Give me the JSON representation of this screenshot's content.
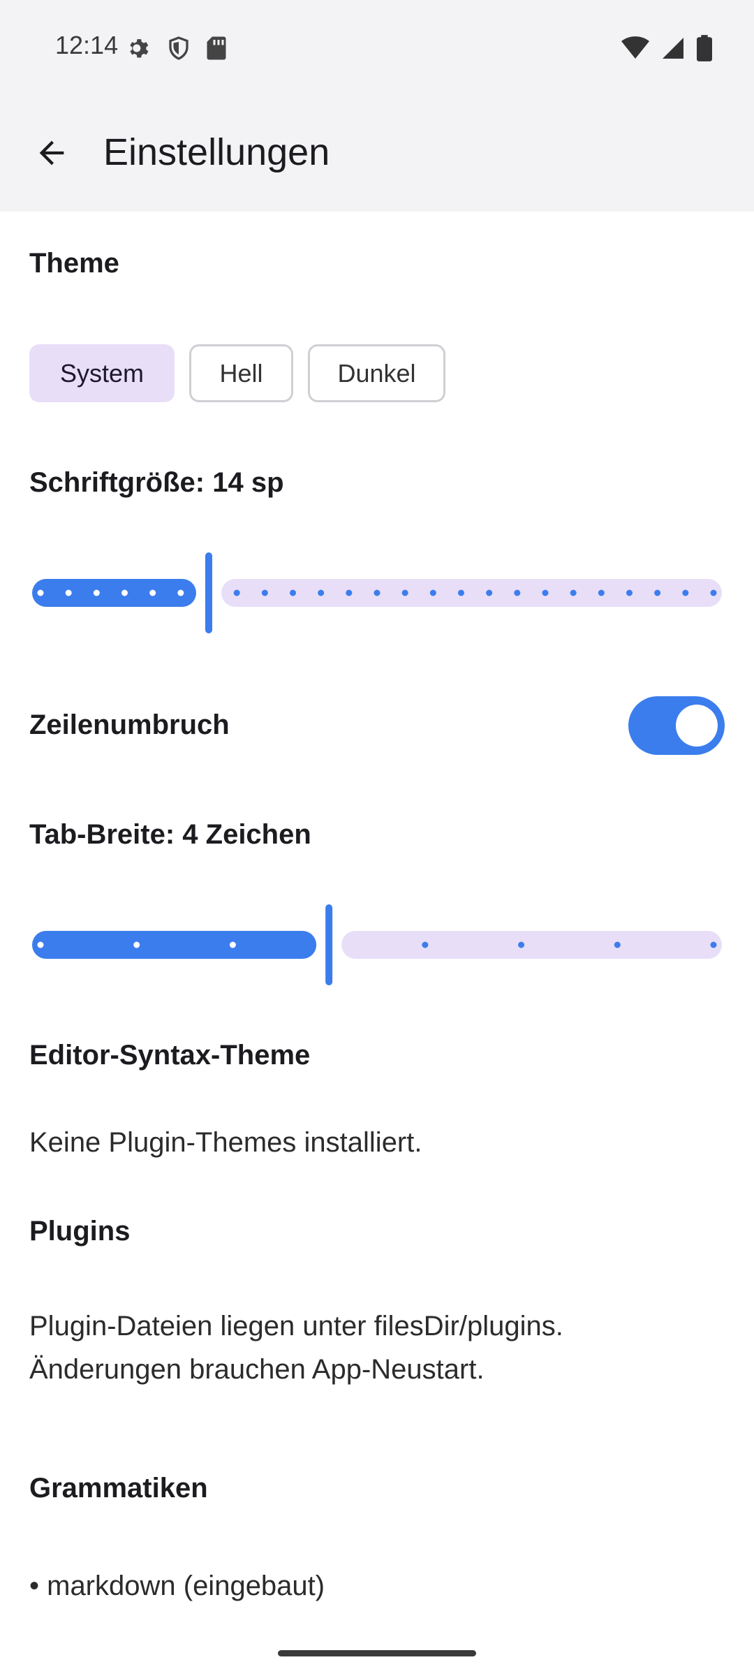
{
  "status": {
    "time": "12:14",
    "left_icons": [
      "gear-icon",
      "shield-icon",
      "sd-card-icon"
    ],
    "right_icons": [
      "wifi-icon",
      "signal-icon",
      "battery-icon"
    ]
  },
  "appbar": {
    "title": "Einstellungen",
    "back_icon": "arrow-back-icon"
  },
  "theme": {
    "title": "Theme",
    "options": [
      {
        "label": "System",
        "selected": true
      },
      {
        "label": "Hell",
        "selected": false
      },
      {
        "label": "Dunkel",
        "selected": false
      }
    ]
  },
  "font_size": {
    "title": "Schriftgröße: 14 sp",
    "value": 14,
    "min": 8,
    "max": 32,
    "step": 1
  },
  "wrap": {
    "title": "Zeilenumbruch",
    "enabled": true
  },
  "tab_width": {
    "title": "Tab-Breite: 4 Zeichen",
    "value": 4,
    "min": 1,
    "max": 8,
    "step": 1
  },
  "editor_theme": {
    "title": "Editor-Syntax-Theme",
    "text": "Keine Plugin-Themes installiert."
  },
  "plugins": {
    "title": "Plugins",
    "line1": "Plugin-Dateien liegen unter filesDir/plugins.",
    "line2": "Änderungen brauchen App-Neustart."
  },
  "grammars": {
    "title": "Grammatiken",
    "items": [
      "• markdown (eingebaut)"
    ]
  },
  "colors": {
    "accent": "#3b7ded",
    "inactive_track": "#e8def8",
    "selected_chip": "#e8def8"
  }
}
